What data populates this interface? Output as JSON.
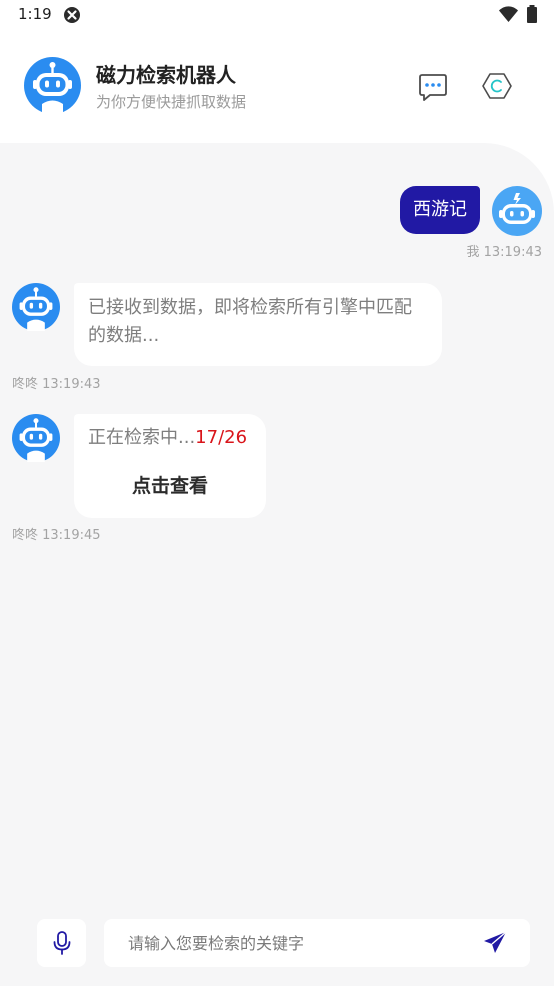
{
  "status_bar": {
    "time": "1:19"
  },
  "header": {
    "title": "磁力检索机器人",
    "subtitle": "为你方便快捷抓取数据"
  },
  "messages": {
    "user": {
      "text": "西游记",
      "meta": "我 13:19:43"
    },
    "bot1": {
      "text": "已接收到数据，即将检索所有引擎中匹配的数据...",
      "meta": "咚咚 13:19:43"
    },
    "bot2": {
      "text": "正在检索中...",
      "count": "17/26",
      "action": "点击查看",
      "meta": "咚咚 13:19:45"
    }
  },
  "input": {
    "placeholder": "请输入您要检索的关键字",
    "value": ""
  },
  "colors": {
    "accent": "#2119a4",
    "bot_blue": "#2a8cf0",
    "count_red": "#d9141a",
    "chat_bg": "#f6f6f7"
  },
  "icons": {
    "status_close": "circle-x-icon",
    "wifi": "wifi-icon",
    "battery": "battery-icon",
    "bot": "robot-icon",
    "chat": "chat-bubble-icon",
    "hexagon": "hexagon-icon",
    "mic": "microphone-icon",
    "send": "send-icon"
  }
}
